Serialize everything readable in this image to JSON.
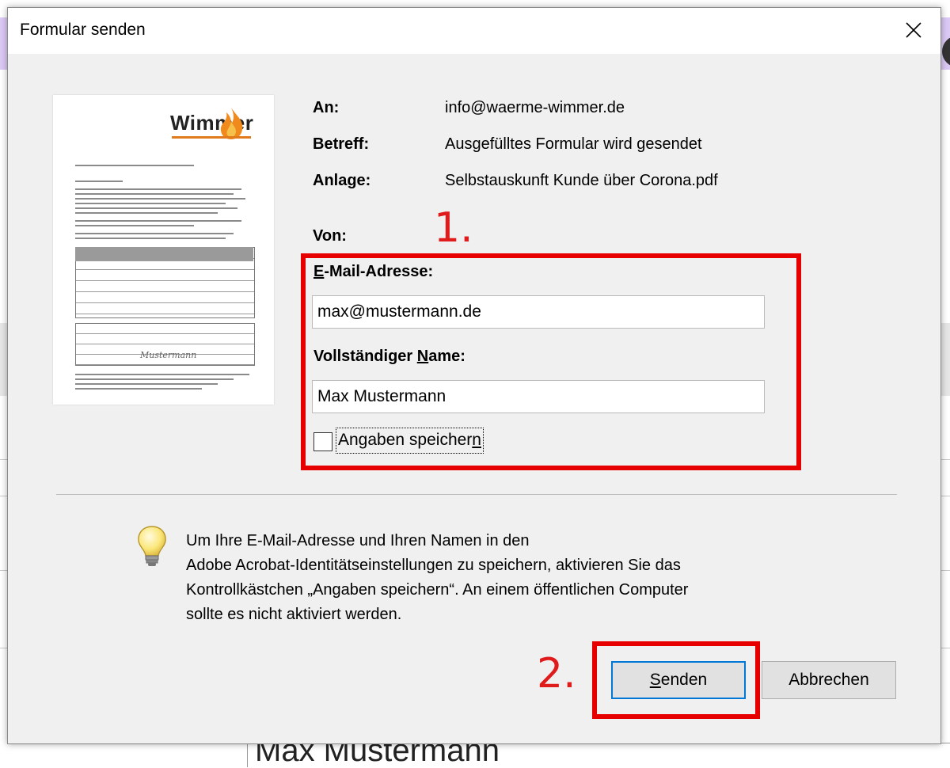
{
  "window": {
    "title": "Formular senden"
  },
  "preview": {
    "logo_text": "Wimmer",
    "signature": "Mustermann"
  },
  "info": {
    "to_label": "An:",
    "to_value": "info@waerme-wimmer.de",
    "subject_label": "Betreff:",
    "subject_value": "Ausgefülltes Formular wird gesendet",
    "attachment_label": "Anlage:",
    "attachment_value": "Selbstauskunft Kunde über Corona.pdf",
    "from_label": "Von:"
  },
  "annotations": {
    "step1": "1.",
    "step2": "2.",
    "box_color": "#e60000"
  },
  "form": {
    "email_label_mnemonic": "E",
    "email_label_rest": "-Mail-Adresse:",
    "email_value": "max@mustermann.de",
    "name_label_pre": "Vollständiger ",
    "name_label_mnemonic": "N",
    "name_label_post": "ame:",
    "name_value": "Max Mustermann",
    "save_label_pre": "Angaben speicher",
    "save_label_mnemonic": "n",
    "save_checked": false
  },
  "hint": {
    "icon": "lightbulb-icon",
    "lines": [
      "Um Ihre E-Mail-Adresse und Ihren Namen in den",
      "Adobe Acrobat-Identitätseinstellungen zu speichern, aktivieren Sie das",
      "Kontrollkästchen „Angaben speichern“. An einem öffentlichen Computer",
      "sollte es nicht aktiviert werden."
    ]
  },
  "buttons": {
    "send_mnemonic": "S",
    "send_rest": "enden",
    "cancel_label": "Abbrechen"
  },
  "background": {
    "bottom_text": "Max Mustermann"
  }
}
